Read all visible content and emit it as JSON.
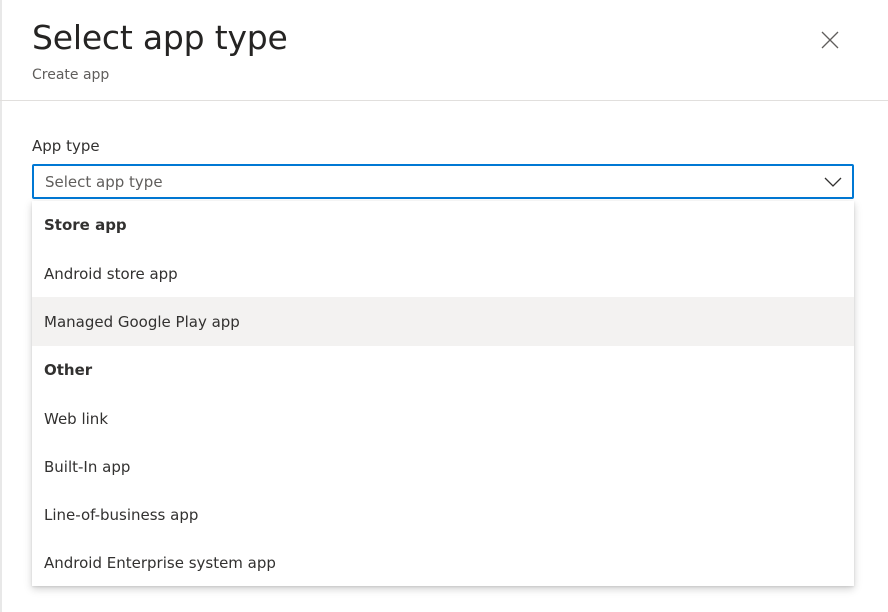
{
  "header": {
    "title": "Select app type",
    "subtitle": "Create app",
    "close_icon": "close-icon"
  },
  "form": {
    "field_label": "App type",
    "select": {
      "value": "Select app type",
      "chevron_icon": "chevron-down-icon",
      "focus_color": "#0078d4"
    }
  },
  "dropdown": {
    "groups": [
      {
        "header": "Store app",
        "options": [
          "Android store app",
          "Managed Google Play app"
        ]
      },
      {
        "header": "Other",
        "options": [
          "Web link",
          "Built-In app",
          "Line-of-business app",
          "Android Enterprise system app"
        ]
      }
    ],
    "hovered_option": "Managed Google Play app",
    "hover_color": "#f3f2f1"
  }
}
